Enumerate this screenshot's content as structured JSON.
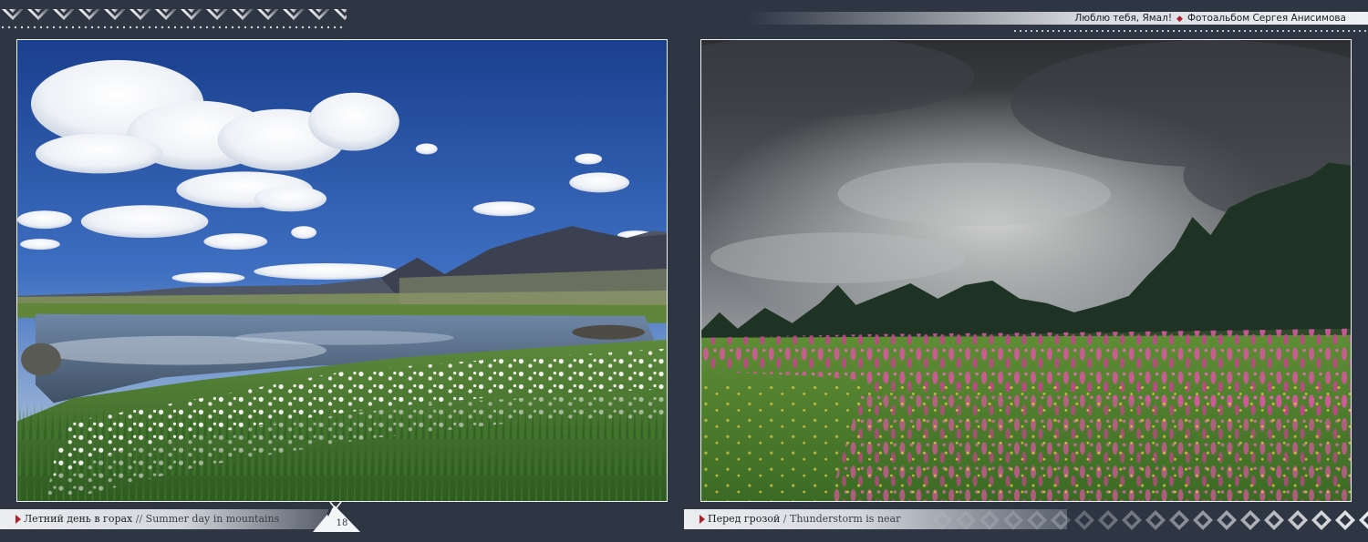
{
  "header": {
    "book_title": "Люблю тебя, Ямал!",
    "separator": "◆",
    "subtitle": "Фотоальбом  Сергея Анисимова"
  },
  "photos": [
    {
      "caption_ru": "Летний день в горах",
      "caption_separator": " // ",
      "caption_en": "Summer day in mountains"
    },
    {
      "caption_ru": "Перед грозой",
      "caption_separator": " / ",
      "caption_en": "Thunderstorm is near"
    }
  ],
  "page_number": "18",
  "colors": {
    "background": "#2e3644",
    "accent": "#b0202a",
    "frame": "#f1f2f4"
  },
  "icons": {
    "caption_marker": "triangle-right-icon",
    "page_mark": "tent-icon"
  }
}
